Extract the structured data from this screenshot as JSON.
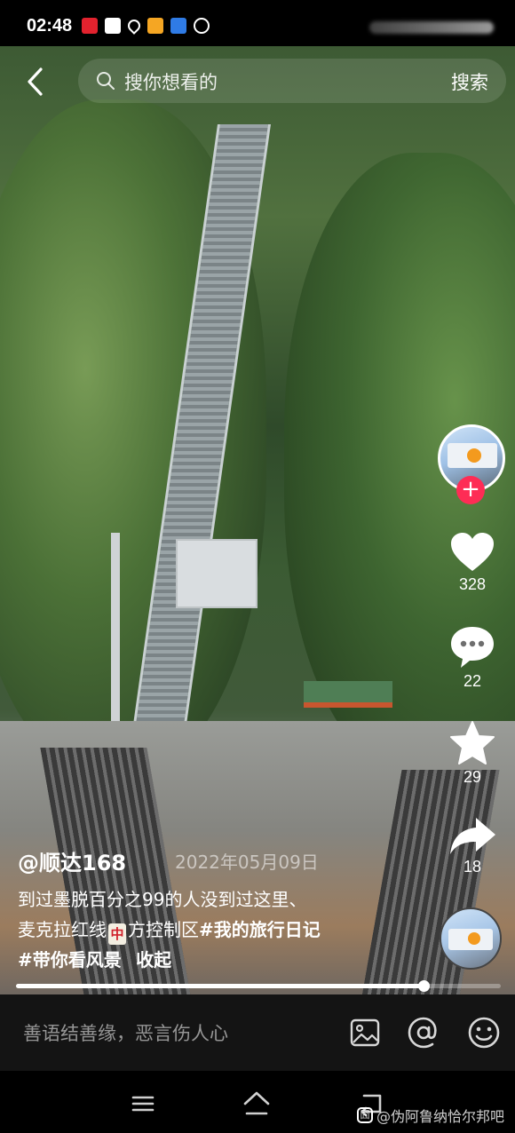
{
  "status_bar": {
    "time": "02:48",
    "icons": [
      "app-icon-red",
      "app-icon-news",
      "location-icon",
      "app-icon-yellow",
      "app-icon-blue",
      "play-icon"
    ]
  },
  "search": {
    "placeholder": "搜你想看的",
    "button_label": "搜索"
  },
  "right_rail": {
    "like_count": "328",
    "comment_count": "22",
    "favorite_count": "29",
    "share_count": "18",
    "follow_symbol": "+"
  },
  "video": {
    "author": "@顺达168",
    "date": "2022年05月09日",
    "description_line1": "到过墨脱百分之99的人没到过这里、",
    "description_line2_prefix": "麦克拉红线",
    "description_tile": "中",
    "description_line2_suffix": "方控制区",
    "hashtag1": "#我的旅行日记",
    "hashtag2": "#带你看风景",
    "collapse_label": "收起",
    "progress": 0.84
  },
  "comment_bar": {
    "placeholder": "善语结善缘，恶言伤人心"
  },
  "watermark": {
    "logo": "囧",
    "text": "@伪阿鲁纳恰尔邦吧"
  },
  "colors": {
    "accent": "#fe2c55",
    "background": "#000000"
  }
}
